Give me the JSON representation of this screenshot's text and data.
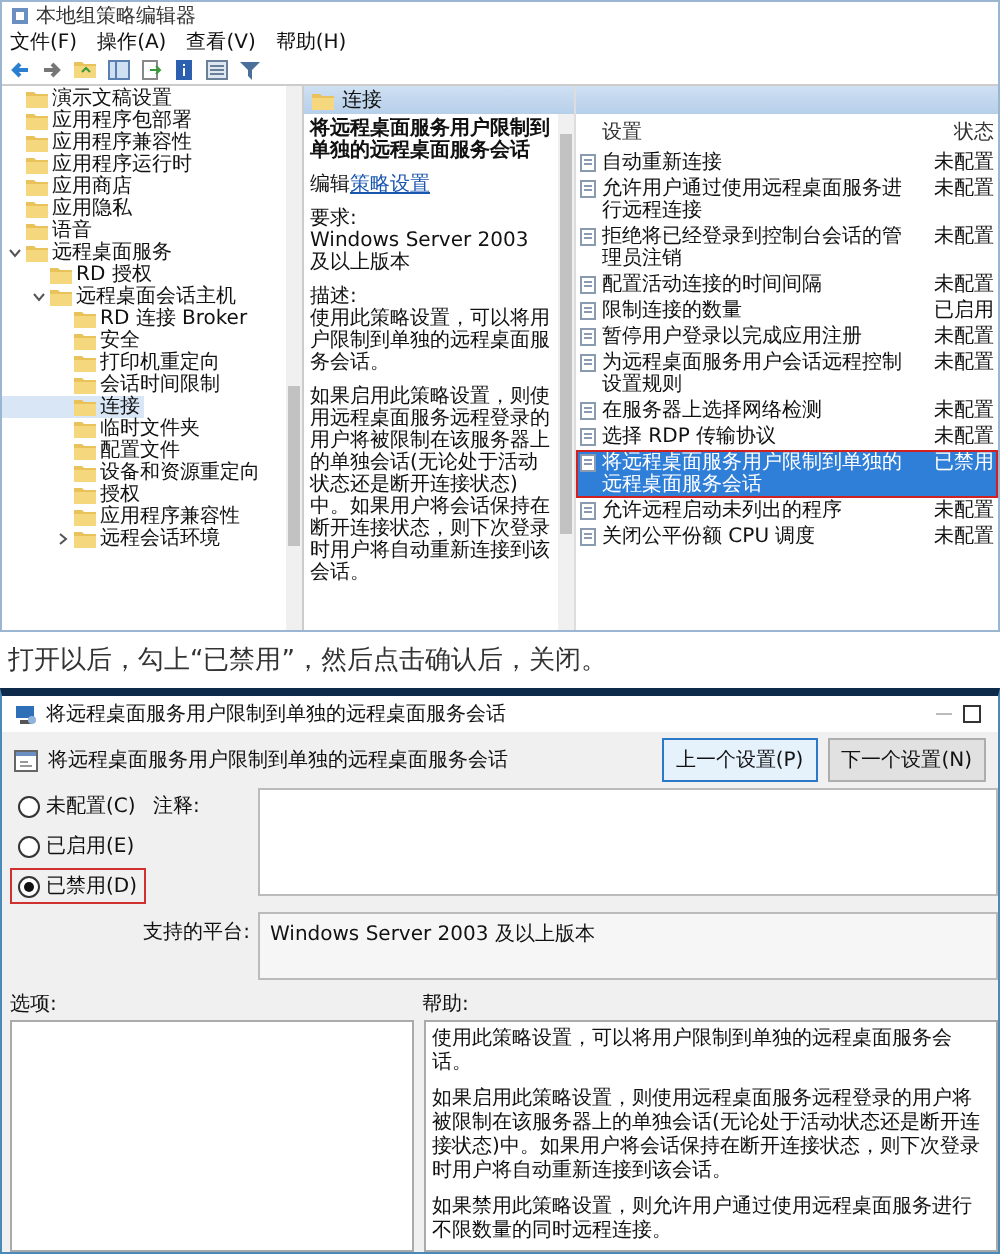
{
  "editor": {
    "window": {
      "title": "本地组策略编辑器"
    },
    "menu": [
      "文件(F)",
      "操作(A)",
      "查看(V)",
      "帮助(H)"
    ],
    "tree": [
      {
        "label": "演示文稿设置",
        "selected": false
      },
      {
        "label": "应用程序包部署",
        "selected": false
      },
      {
        "label": "应用程序兼容性",
        "selected": false
      },
      {
        "label": "应用程序运行时",
        "selected": false
      },
      {
        "label": "应用商店",
        "selected": false
      },
      {
        "label": "应用隐私",
        "selected": false
      },
      {
        "label": "语音",
        "selected": false
      },
      {
        "label": "远程桌面服务",
        "expanded": true,
        "selected": false,
        "children": [
          {
            "label": "RD 授权",
            "selected": false
          },
          {
            "label": "远程桌面会话主机",
            "expanded": true,
            "selected": false,
            "children": [
              {
                "label": "RD 连接 Broker",
                "selected": false
              },
              {
                "label": "安全",
                "selected": false
              },
              {
                "label": "打印机重定向",
                "selected": false
              },
              {
                "label": "会话时间限制",
                "selected": false
              },
              {
                "label": "连接",
                "selected": true
              },
              {
                "label": "临时文件夹",
                "selected": false
              },
              {
                "label": "配置文件",
                "selected": false
              },
              {
                "label": "设备和资源重定向",
                "selected": false
              },
              {
                "label": "授权",
                "selected": false
              },
              {
                "label": "应用程序兼容性",
                "selected": false
              },
              {
                "label": "远程会话环境",
                "expanded": false,
                "selected": false
              }
            ]
          }
        ]
      }
    ],
    "detail": {
      "header": "连接",
      "title": "将远程桌面服务用户限制到单独的远程桌面服务会话",
      "edit_prefix": "编辑",
      "edit_link": "策略设置",
      "requirement_label": "要求:",
      "requirement": "Windows Server 2003 及以上版本",
      "description_label": "描述:",
      "description": [
        "使用此策略设置，可以将用户限制到单独的远程桌面服务会话。",
        "如果启用此策略设置，则使用远程桌面服务远程登录的用户将被限制在该服务器上的单独会话(无论处于活动状态还是断开连接状态)中。如果用户将会话保持在断开连接状态，则下次登录时用户将自动重新连接到该会话。"
      ]
    },
    "settings": {
      "columns": [
        "设置",
        "状态"
      ],
      "rows": [
        {
          "name": "自动重新连接",
          "state": "未配置",
          "selected": false
        },
        {
          "name": "允许用户通过使用远程桌面服务进行远程连接",
          "state": "未配置",
          "selected": false
        },
        {
          "name": "拒绝将已经登录到控制台会话的管理员注销",
          "state": "未配置",
          "selected": false
        },
        {
          "name": "配置活动连接的时间间隔",
          "state": "未配置",
          "selected": false
        },
        {
          "name": "限制连接的数量",
          "state": "已启用",
          "selected": false
        },
        {
          "name": "暂停用户登录以完成应用注册",
          "state": "未配置",
          "selected": false
        },
        {
          "name": "为远程桌面服务用户会话远程控制设置规则",
          "state": "未配置",
          "selected": false
        },
        {
          "name": "在服务器上选择网络检测",
          "state": "未配置",
          "selected": false
        },
        {
          "name": "选择 RDP 传输协议",
          "state": "未配置",
          "selected": false
        },
        {
          "name": "将远程桌面服务用户限制到单独的远程桌面服务会话",
          "state": "已禁用",
          "selected": true
        },
        {
          "name": "允许远程启动未列出的程序",
          "state": "未配置",
          "selected": false
        },
        {
          "name": "关闭公平份额 CPU 调度",
          "state": "未配置",
          "selected": false
        }
      ]
    }
  },
  "instruction": "打开以后，勾上“已禁用”，然后点击确认后，关闭。",
  "dialog": {
    "title": "将远程桌面服务用户限制到单独的远程桌面服务会话",
    "heading": "将远程桌面服务用户限制到单独的远程桌面服务会话",
    "buttons": [
      {
        "label": "上一个设置(P)",
        "focused": true
      },
      {
        "label": "下一个设置(N)",
        "focused": false
      }
    ],
    "options": [
      {
        "label": "未配置(C)",
        "selected": false
      },
      {
        "label": "已启用(E)",
        "selected": false
      },
      {
        "label": "已禁用(D)",
        "selected": true
      }
    ],
    "comment_label": "注释:",
    "platform_label": "支持的平台:",
    "platform": "Windows Server 2003 及以上版本",
    "options_label": "选项:",
    "help_label": "帮助:",
    "help": [
      "使用此策略设置，可以将用户限制到单独的远程桌面服务会话。",
      "如果启用此策略设置，则使用远程桌面服务远程登录的用户将被限制在该服务器上的单独会话(无论处于活动状态还是断开连接状态)中。如果用户将会话保持在断开连接状态，则下次登录时用户将自动重新连接到该会话。",
      "如果禁用此策略设置，则允许用户通过使用远程桌面服务进行不限数量的同时远程连接。"
    ]
  }
}
